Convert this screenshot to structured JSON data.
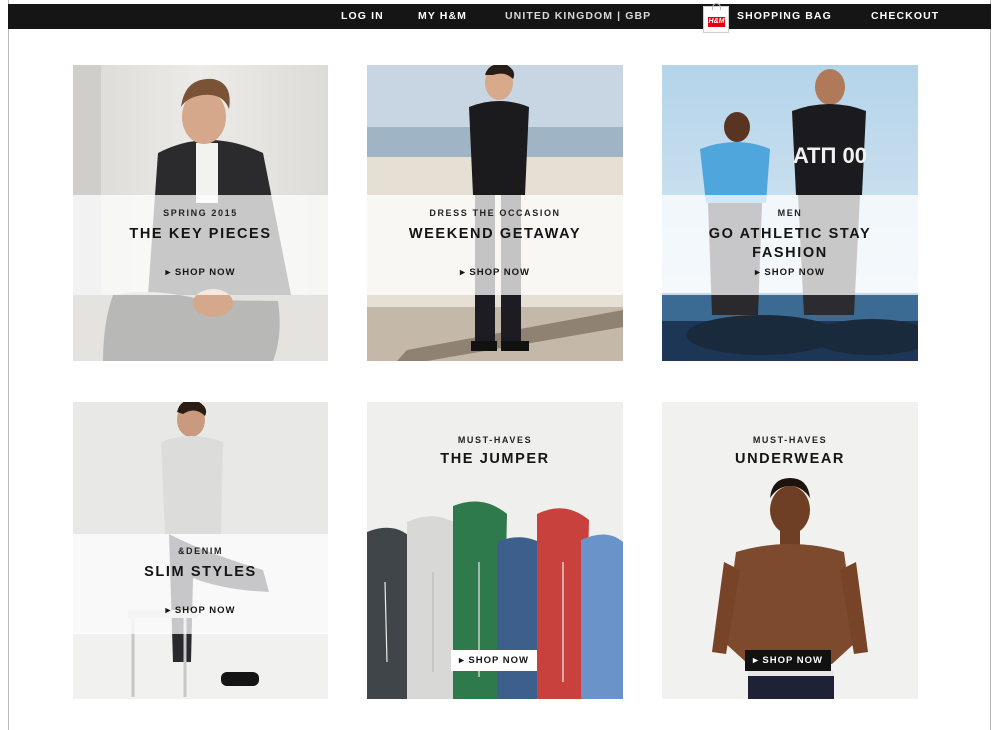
{
  "topbar": {
    "login": "LOG IN",
    "my_hm": "MY H&M",
    "country": "UNITED KINGDOM | GBP",
    "bag_logo": "H&M",
    "shopping_bag": "SHOPPING BAG",
    "checkout": "CHECKOUT"
  },
  "tiles": [
    {
      "eyebrow": "SPRING 2015",
      "title": "THE KEY PIECES",
      "cta": "▸ SHOP NOW"
    },
    {
      "eyebrow": "DRESS THE OCCASION",
      "title": "WEEKEND GETAWAY",
      "cta": "▸ SHOP NOW"
    },
    {
      "eyebrow": "MEN",
      "title_line1": "GO ATHLETIC STAY",
      "title_line2": "FASHION",
      "cta": "▸ SHOP NOW"
    },
    {
      "eyebrow": "&DENIM",
      "title": "SLIM STYLES",
      "cta": "▸ SHOP NOW"
    },
    {
      "eyebrow": "MUST-HAVES",
      "title": "THE JUMPER",
      "cta": "▸ SHOP NOW"
    },
    {
      "eyebrow": "MUST-HAVES",
      "title": "UNDERWEAR",
      "cta": "▸ SHOP NOW"
    }
  ],
  "jersey_text": "ΑΤΠ 00",
  "colors": {
    "topbar": "#151515",
    "brand_red": "#e50010",
    "sky": "#bcd8ea",
    "jumper_green": "#2f7a4c",
    "jumper_red": "#c9413c",
    "jumper_blue": "#6a93c9"
  }
}
